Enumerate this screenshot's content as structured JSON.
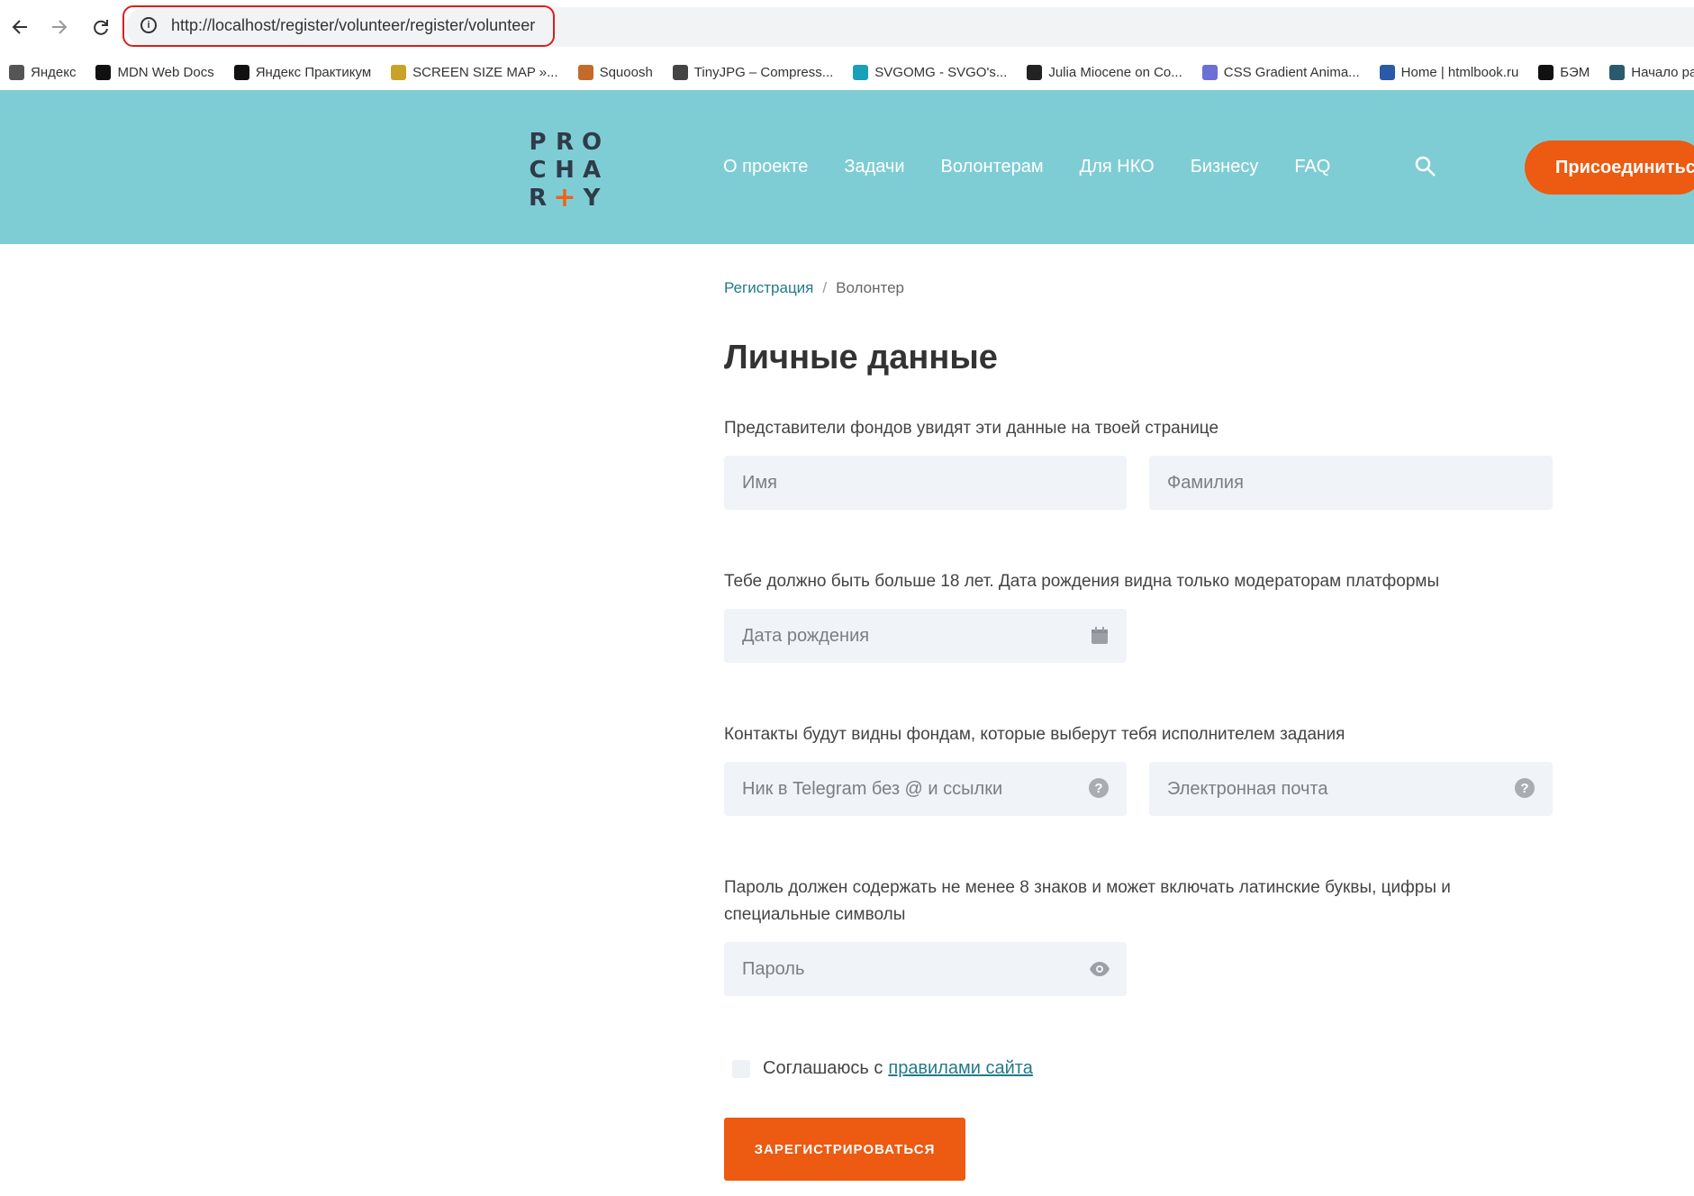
{
  "browser": {
    "url": "http://localhost/register/volunteer/register/volunteer",
    "bookmarks": [
      {
        "label": "Яндекс",
        "icon": "globe-icon",
        "color": "#555555"
      },
      {
        "label": "MDN Web Docs",
        "icon": "mdn-icon",
        "color": "#111111"
      },
      {
        "label": "Яндекс Практикум",
        "icon": "practicum-icon",
        "color": "#111111"
      },
      {
        "label": "SCREEN SIZE MAP »...",
        "icon": "screensize-icon",
        "color": "#c9a227"
      },
      {
        "label": "Squoosh",
        "icon": "squoosh-icon",
        "color": "#c46a2b"
      },
      {
        "label": "TinyJPG – Compress...",
        "icon": "panda-icon",
        "color": "#444444"
      },
      {
        "label": "SVGOMG - SVGO's...",
        "icon": "svgomg-icon",
        "color": "#1aa0b8"
      },
      {
        "label": "Julia Miocene on Co...",
        "icon": "codepen-icon",
        "color": "#222222"
      },
      {
        "label": "CSS Gradient Anima...",
        "icon": "gradient-icon",
        "color": "#6b6fd6"
      },
      {
        "label": "Home | htmlbook.ru",
        "icon": "htmlbook-icon",
        "color": "#2a5aa8"
      },
      {
        "label": "БЭМ",
        "icon": "bem-icon",
        "color": "#111111"
      },
      {
        "label": "Начало работы",
        "icon": "react-icon",
        "color": "#2a5a6b"
      }
    ]
  },
  "header": {
    "logo_letters": [
      "P",
      "R",
      "O",
      "C",
      "H",
      "A",
      "R",
      "+",
      "Y"
    ],
    "nav": [
      "О проекте",
      "Задачи",
      "Волонтерам",
      "Для НКО",
      "Бизнесу",
      "FAQ"
    ],
    "join_label": "Присоединиться",
    "colors": {
      "header_bg": "#7fcdd4",
      "accent": "#ed5a11"
    }
  },
  "breadcrumb": {
    "link": "Регистрация",
    "separator": "/",
    "current": "Волонтер"
  },
  "form": {
    "title": "Личные данные",
    "hint_name": "Представители фондов увидят эти данные на твоей странице",
    "first_name_placeholder": "Имя",
    "last_name_placeholder": "Фамилия",
    "hint_birth": "Тебе должно быть больше 18 лет. Дата рождения видна только модераторам платформы",
    "birth_placeholder": "Дата рождения",
    "hint_contacts": "Контакты будут видны фондам, которые выберут тебя исполнителем задания",
    "telegram_placeholder": "Ник в Telegram без @ и ссылки",
    "email_placeholder": "Электронная почта",
    "hint_password": "Пароль должен содержать не менее 8 знаков и может включать латинские буквы, цифры и специальные символы",
    "password_placeholder": "Пароль",
    "agree_text": "Соглашаюсь с",
    "agree_link": "правилами сайта",
    "submit_label": "ЗАРЕГИСТРИРОВАТЬСЯ",
    "help_symbol": "?"
  }
}
